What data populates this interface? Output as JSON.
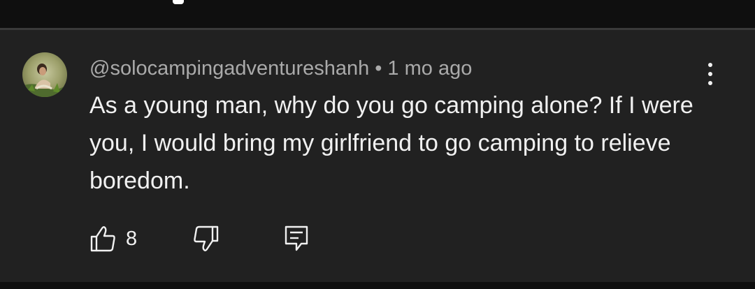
{
  "comment": {
    "avatar_icon": "user-avatar-photo",
    "author": "@solocampingadventureshanh",
    "separator": "•",
    "time_ago": "1 mo ago",
    "text": "As a young man, why do you go camping alone? If I were you, I would bring my girlfriend to go camping to relieve boredom.",
    "more_icon": "more-vertical-icon"
  },
  "actions": {
    "like_icon": "thumbs-up-icon",
    "like_count": "8",
    "dislike_icon": "thumbs-down-icon",
    "reply_icon": "reply-comment-icon"
  },
  "colors": {
    "background": "#0f0f0f",
    "card": "#212121",
    "primary_text": "#f1f1f1",
    "secondary_text": "#aaaaaa"
  }
}
